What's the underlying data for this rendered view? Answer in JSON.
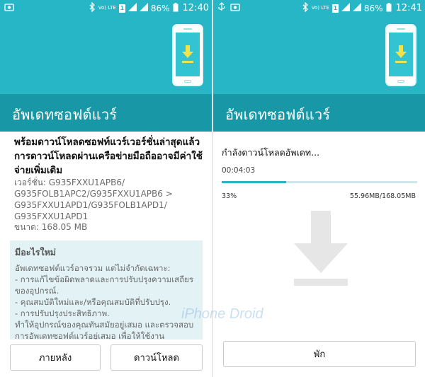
{
  "status_left": {
    "battery_pct": "86%",
    "time": "12:40",
    "lte_label": "Vo) LTE"
  },
  "status_right": {
    "battery_pct": "86%",
    "time": "12:41",
    "lte_label": "Vo) LTE"
  },
  "screen_left": {
    "title": "อัพเดทซอฟต์แวร์",
    "lead": "พร้อมดาวน์โหลดซอฟท์แวร์เวอร์ชั่นล่าสุดแล้ว การดาวน์โหลดผ่านเครือข่ายมือถืออาจมีค่าใช้จ่ายเพิ่มเติม",
    "version": "เวอร์ชั่น: G935FXXU1APB6/ G935FOLB1APC2/G935FXXU1APB6 > G935FXXU1APD1/G935FOLB1APD1/ G935FXXU1APD1",
    "size": "ขนาด: 168.05 MB",
    "whats_new_title": "มีอะไรใหม่",
    "whats_new_body": "อัพเดทซอฟต์แวร์อาจรวม แต่ไม่จำกัดเฉพาะ:\n - การแก้ไขข้อผิดพลาดและการปรับปรุงความเสถียรของอุปกรณ์.\n - คุณสมบัติใหม่และ/หรือคุณสมบัติที่ปรับปรุง.\n - การปรับปรุงประสิทธิภาพ.\nทำให้อุปกรณ์ของคุณทันสมัยอยู่เสมอ และตรวจสอบการอัพเดทซอฟต์แวร์อยู่เสมอ เพื่อให้ใช้งาน",
    "later_label": "ภายหลัง",
    "download_label": "ดาวน์โหลด"
  },
  "screen_right": {
    "title": "อัพเดทซอฟต์แวร์",
    "status": "กำลังดาวน์โหลดอัพเดท...",
    "elapsed": "00:04:03",
    "percent_text": "33%",
    "progress_fraction": 0.33,
    "bytes": "55.96MB/168.05MB",
    "pause_label": "พัก"
  },
  "watermark_text": "iPhone Droid",
  "colors": {
    "status_bg": "#27b6c6",
    "appbar_bg": "#1898a6",
    "accent": "#27b6c6",
    "whats_new_bg": "#e3f2f5"
  },
  "icons": [
    "bluetooth-icon",
    "wifi-signal-icon",
    "cell-signal-icon",
    "battery-icon",
    "download-arrow-icon",
    "phone-download-icon"
  ]
}
